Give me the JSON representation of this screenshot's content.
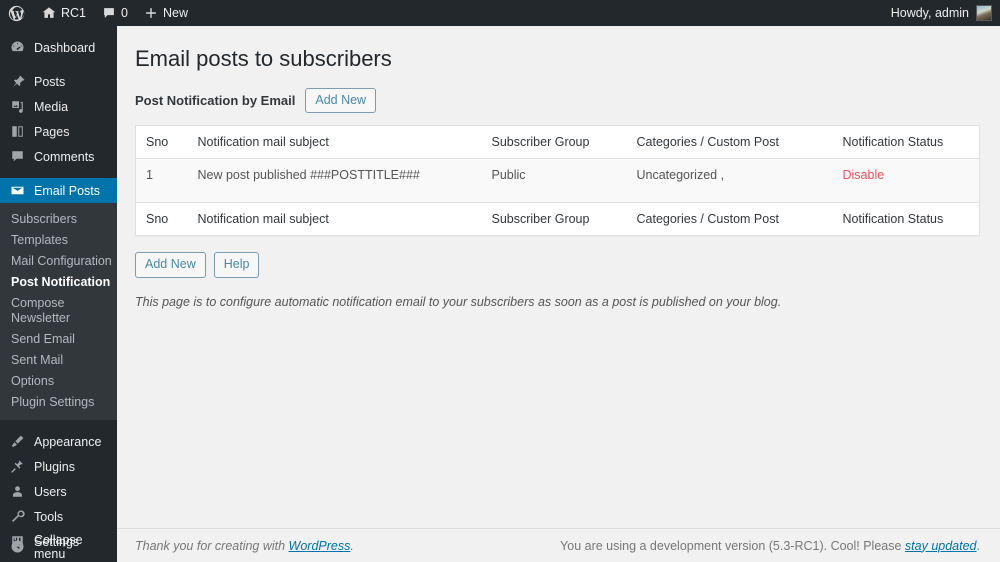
{
  "adminbar": {
    "logo_icon": "wordpress-logo-icon",
    "site": {
      "icon": "home-icon",
      "label": "RC1"
    },
    "comments": {
      "icon": "comment-bubble-icon",
      "count": "0"
    },
    "new": {
      "icon": "plus-icon",
      "label": "New"
    },
    "howdy": "Howdy, admin",
    "avatar_icon": "user-avatar"
  },
  "sidebar": {
    "items": [
      {
        "label": "Dashboard",
        "icon": "dashboard-icon"
      },
      {
        "label": "Posts",
        "icon": "pin-icon"
      },
      {
        "label": "Media",
        "icon": "media-icon"
      },
      {
        "label": "Pages",
        "icon": "pages-icon"
      },
      {
        "label": "Comments",
        "icon": "comment-icon"
      },
      {
        "label": "Email Posts",
        "icon": "envelope-icon"
      },
      {
        "label": "Appearance",
        "icon": "brush-icon"
      },
      {
        "label": "Plugins",
        "icon": "plug-icon"
      },
      {
        "label": "Users",
        "icon": "user-icon"
      },
      {
        "label": "Tools",
        "icon": "wrench-icon"
      },
      {
        "label": "Settings",
        "icon": "settings-icon"
      }
    ],
    "submenu": [
      {
        "label": "Subscribers"
      },
      {
        "label": "Templates"
      },
      {
        "label": "Mail Configuration"
      },
      {
        "label": "Post Notification"
      },
      {
        "label": "Compose Newsletter"
      },
      {
        "label": "Send Email"
      },
      {
        "label": "Sent Mail"
      },
      {
        "label": "Options"
      },
      {
        "label": "Plugin Settings"
      }
    ],
    "collapse": {
      "label": "Collapse menu",
      "icon": "collapse-arrow-icon"
    }
  },
  "page": {
    "title": "Email posts to subscribers",
    "subhead": "Post Notification by Email",
    "add_new_top": "Add New",
    "add_new_bottom": "Add New",
    "help": "Help",
    "description": "This page is to configure automatic notification email to your subscribers as soon as a post is published on your blog."
  },
  "table": {
    "columns": [
      "Sno",
      "Notification mail subject",
      "Subscriber Group",
      "Categories / Custom Post",
      "Notification Status"
    ],
    "rows": [
      {
        "sno": "1",
        "subject": "New post published ###POSTTITLE###",
        "group": "Public",
        "categories": "Uncategorized ,",
        "status": "Disable"
      }
    ]
  },
  "footer": {
    "thanks_prefix": "Thank you for creating with ",
    "thanks_link": "WordPress",
    "thanks_suffix": ".",
    "version_prefix": "You are using a development version (5.3-RC1). Cool! Please ",
    "version_link": "stay updated",
    "version_suffix": "."
  },
  "colors": {
    "admin_bg": "#23282d",
    "accent": "#0073aa",
    "status_red": "#f0505a",
    "link_blue": "#0073aa"
  }
}
